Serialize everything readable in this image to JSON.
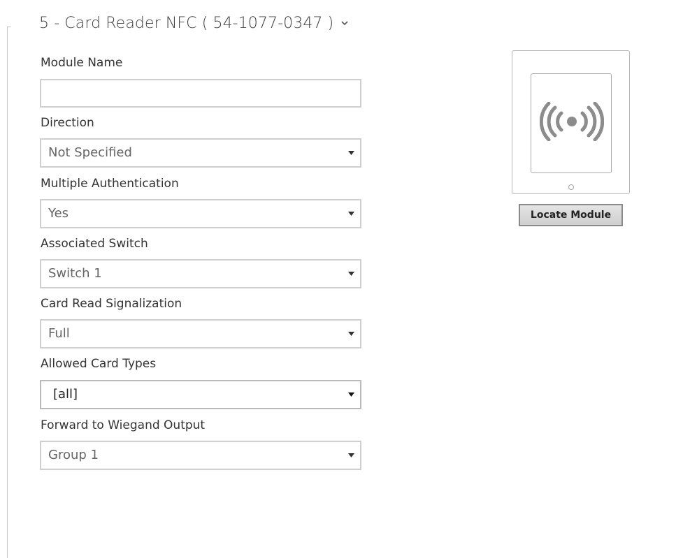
{
  "module": {
    "title": "5 - Card Reader NFC ( 54-1077-0347 )",
    "chevron_icon": "chevron-down-icon"
  },
  "fields": {
    "module_name": {
      "label": "Module Name",
      "value": "",
      "placeholder": ""
    },
    "direction": {
      "label": "Direction",
      "value": "Not Specified"
    },
    "multiple_authentication": {
      "label": "Multiple Authentication",
      "value": "Yes"
    },
    "associated_switch": {
      "label": "Associated Switch",
      "value": "Switch 1"
    },
    "card_read_signalization": {
      "label": "Card Read Signalization",
      "value": "Full"
    },
    "allowed_card_types": {
      "label": "Allowed Card Types",
      "value": "[all]"
    },
    "forward_to_wiegand": {
      "label": "Forward to Wiegand Output",
      "value": "Group 1"
    }
  },
  "device_preview": {
    "icon": "nfc-icon",
    "locate_button_label": "Locate Module"
  },
  "colors": {
    "border": "#cfcfcf",
    "text": "#333333",
    "muted_value": "#666666",
    "button_bg": "#d9d9d9",
    "icon_gray": "#8c8c8c"
  }
}
